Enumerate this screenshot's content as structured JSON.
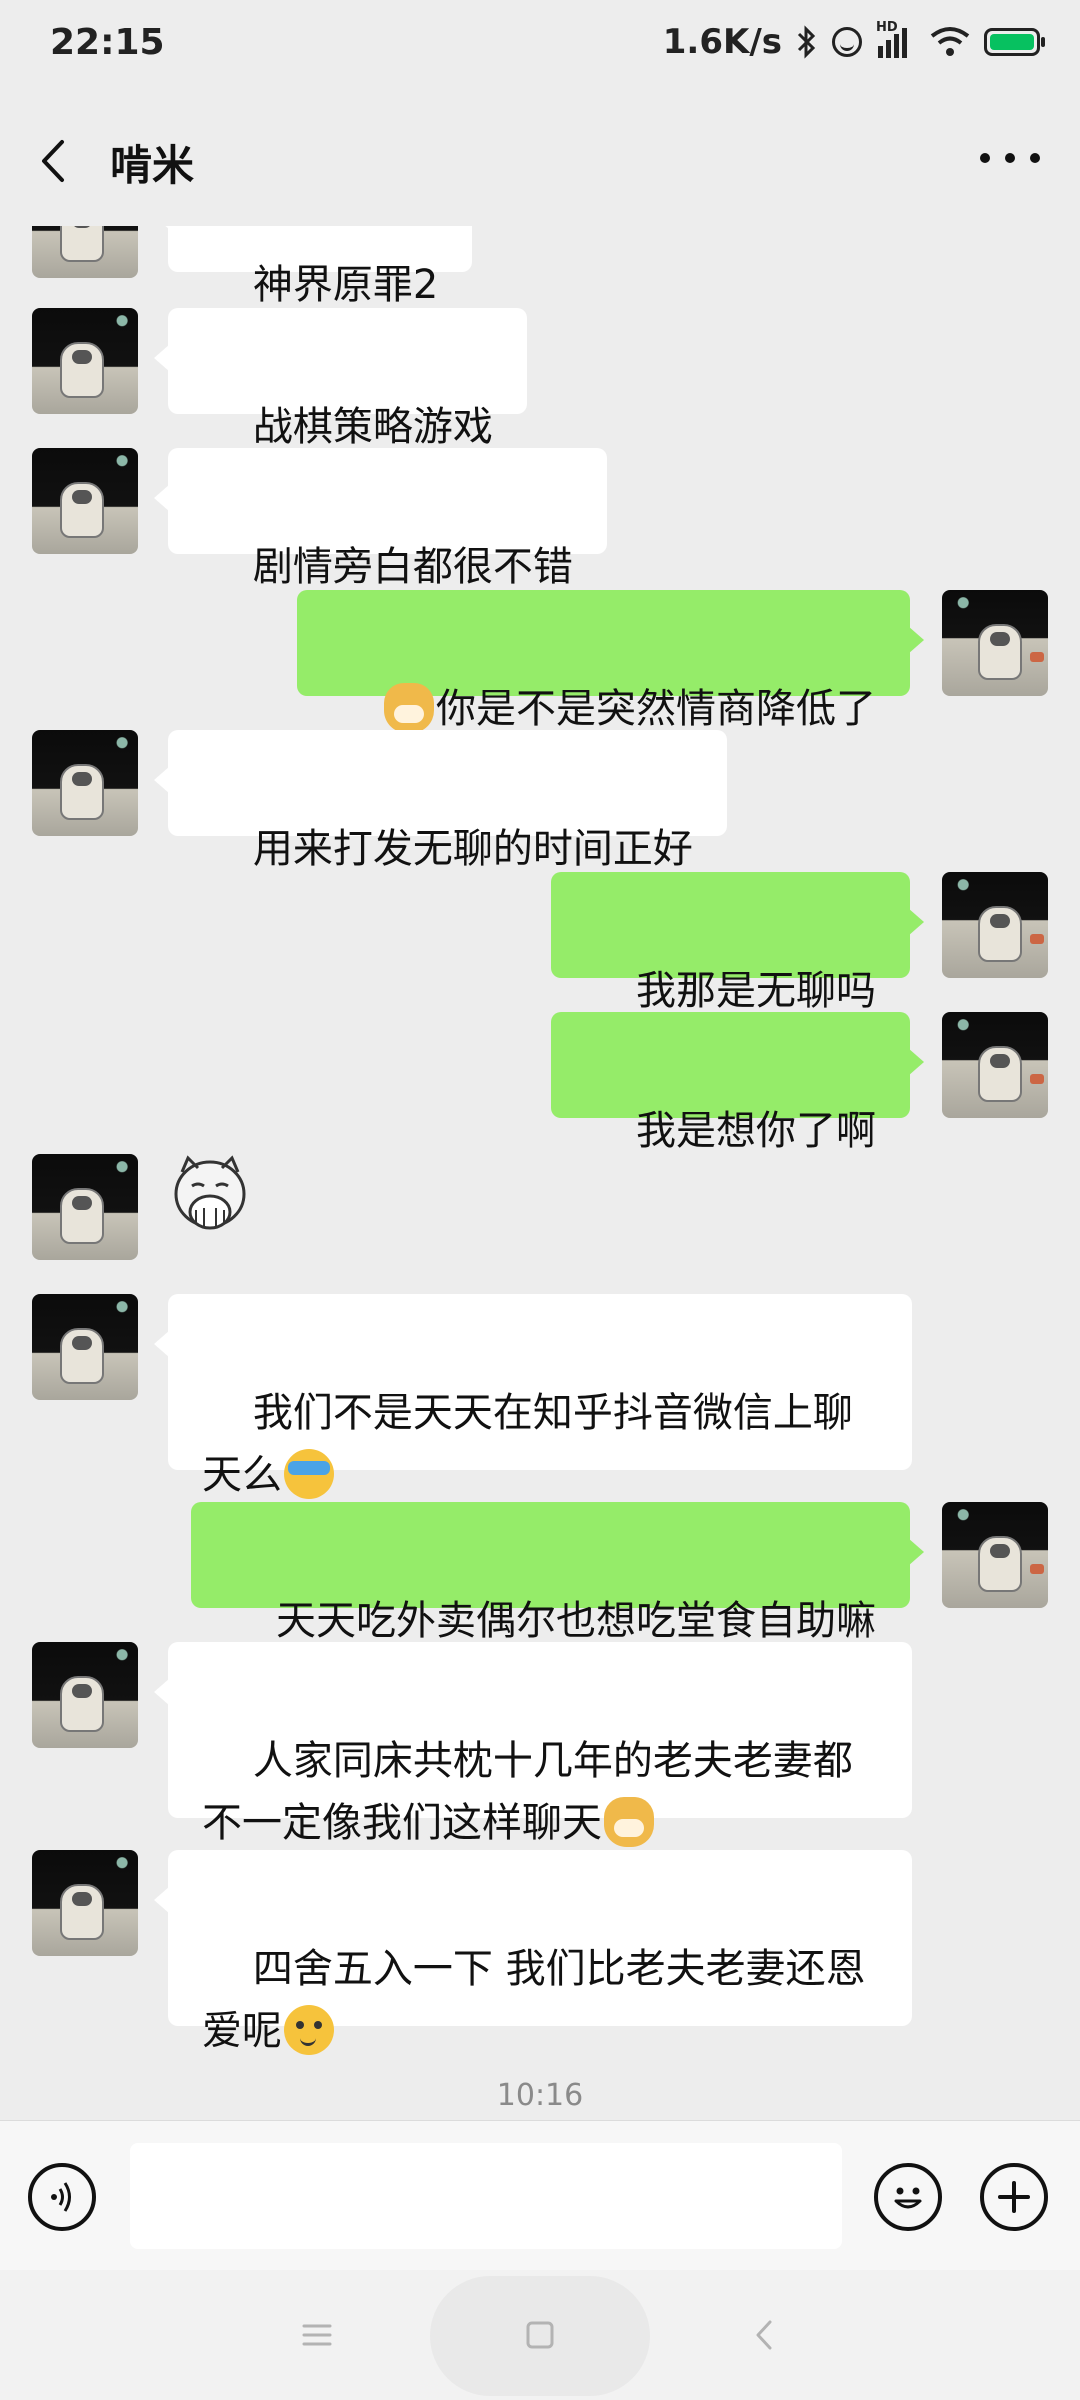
{
  "status_bar": {
    "time": "22:15",
    "network_speed": "1.6K/s",
    "hd_label": "HD"
  },
  "header": {
    "title": "啃米",
    "back_icon": "chevron-left-icon",
    "more_icon": "more-horizontal-icon"
  },
  "messages": [
    {
      "side": "left",
      "text": "神界原罪2",
      "partial": true
    },
    {
      "side": "left",
      "text": "战棋策略游戏"
    },
    {
      "side": "left",
      "text": "剧情旁白都很不错"
    },
    {
      "side": "right",
      "text": "你是不是突然情商降低了",
      "emoji_before": "doge-emoji"
    },
    {
      "side": "left",
      "text": "用来打发无聊的时间正好"
    },
    {
      "side": "right",
      "text": "我那是无聊吗"
    },
    {
      "side": "right",
      "text": "我是想你了啊"
    },
    {
      "side": "left",
      "sticker": "cat-covering-mouth-sticker"
    },
    {
      "side": "left",
      "text": "我们不是天天在知乎抖音微信上聊天么",
      "emoji_after": "facepalm-emoji"
    },
    {
      "side": "right",
      "text": "天天吃外卖偶尔也想吃堂食自助嘛"
    },
    {
      "side": "left",
      "text": "人家同床共枕十几年的老夫老妻都不一定像我们这样聊天",
      "emoji_after": "doge-emoji"
    },
    {
      "side": "left",
      "text": "四舍五入一下 我们比老夫老妻还恩爱呢",
      "emoji_after": "smirk-emoji"
    }
  ],
  "timestamp": "10:16",
  "input_bar": {
    "voice_icon": "voice-icon",
    "emoji_icon": "emoji-icon",
    "plus_icon": "plus-icon",
    "input_value": ""
  },
  "colors": {
    "background": "#ededed",
    "bubble_self": "#95ec69",
    "bubble_other": "#ffffff",
    "battery": "#07c160"
  },
  "nav": {
    "menu_icon": "menu-icon",
    "home_icon": "home-icon",
    "back_icon": "back-icon"
  }
}
